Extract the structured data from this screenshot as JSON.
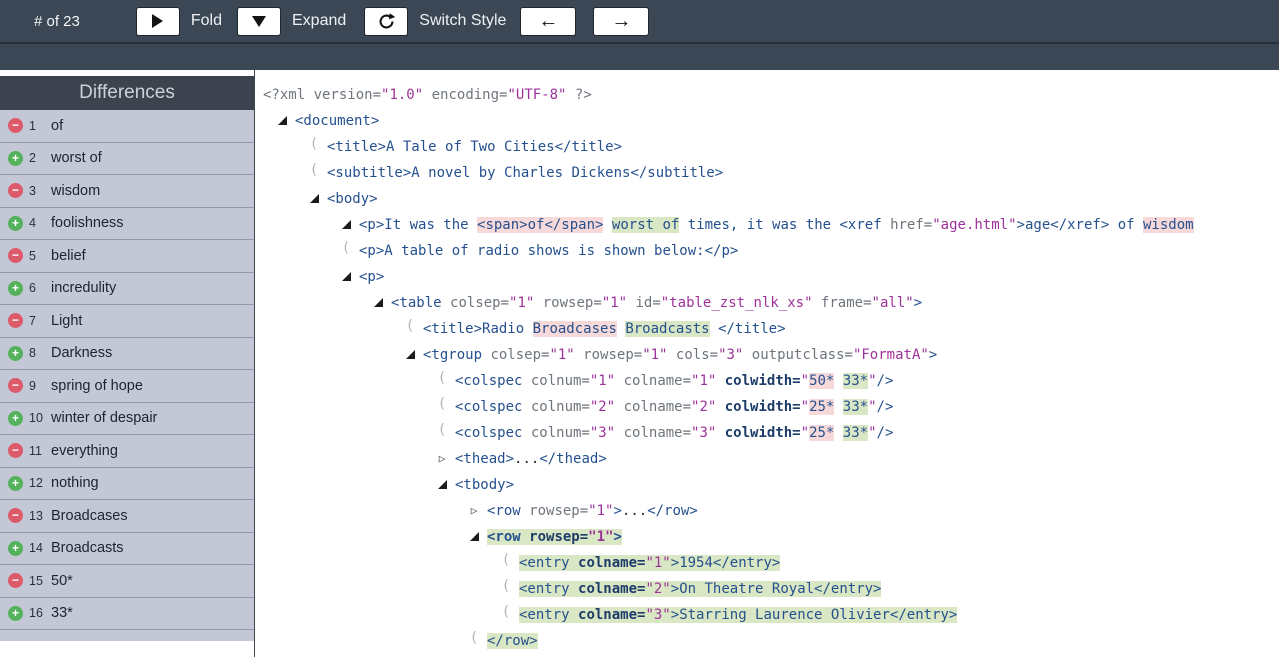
{
  "toolbar": {
    "counter": "# of 23",
    "buttons": [
      {
        "name": "fold",
        "icon": "play-icon",
        "label": "Fold"
      },
      {
        "name": "expand",
        "icon": "triangle-down-icon",
        "label": "Expand"
      },
      {
        "name": "switch-style",
        "icon": "refresh-icon",
        "label": "Switch Style"
      },
      {
        "name": "previous-difference",
        "icon": "arrow-left-icon",
        "label": ""
      },
      {
        "name": "next-difference",
        "icon": "arrow-right-icon",
        "label": ""
      }
    ],
    "arrow_left": "←",
    "arrow_right": "→"
  },
  "sidebar": {
    "title": "Differences",
    "items": [
      {
        "num": 1,
        "kind": "removed",
        "label": "of"
      },
      {
        "num": 2,
        "kind": "added",
        "label": "worst of"
      },
      {
        "num": 3,
        "kind": "removed",
        "label": "wisdom"
      },
      {
        "num": 4,
        "kind": "added",
        "label": "foolishness"
      },
      {
        "num": 5,
        "kind": "removed",
        "label": "belief"
      },
      {
        "num": 6,
        "kind": "added",
        "label": "incredulity"
      },
      {
        "num": 7,
        "kind": "removed",
        "label": "Light"
      },
      {
        "num": 8,
        "kind": "added",
        "label": "Darkness"
      },
      {
        "num": 9,
        "kind": "removed",
        "label": "spring of hope"
      },
      {
        "num": 10,
        "kind": "added",
        "label": "winter of despair"
      },
      {
        "num": 11,
        "kind": "removed",
        "label": "everything"
      },
      {
        "num": 12,
        "kind": "added",
        "label": "nothing"
      },
      {
        "num": 13,
        "kind": "removed",
        "label": "Broadcases"
      },
      {
        "num": 14,
        "kind": "added",
        "label": "Broadcasts"
      },
      {
        "num": 15,
        "kind": "removed",
        "label": "50*"
      },
      {
        "num": 16,
        "kind": "added",
        "label": "33*"
      }
    ]
  },
  "colors": {
    "toolbar_bg": "#3b4754",
    "sidebar_row_bg": "#c4c8d6",
    "removed_badge": "#dd5a6b",
    "added_badge": "#55b25c",
    "removed_hl": "#f8d9da",
    "added_hl": "#d9e7c4",
    "tag_color": "#25508e",
    "attr_color": "#6e757d",
    "value_color": "#9d329a"
  },
  "editor": {
    "lines": [
      {
        "fold": "none",
        "indent": 0,
        "segs": [
          [
            "pi",
            "<?xml version="
          ],
          [
            "val",
            "\"1.0\""
          ],
          [
            "pi",
            " encoding="
          ],
          [
            "val",
            "\"UTF-8\""
          ],
          [
            "pi",
            " ?>"
          ]
        ]
      },
      {
        "fold": "open",
        "indent": 1,
        "segs": [
          [
            "tag",
            "<document>"
          ]
        ]
      },
      {
        "fold": "brace",
        "indent": 2,
        "segs": [
          [
            "tag",
            "<title>"
          ],
          [
            "txt",
            "A Tale of Two Cities"
          ],
          [
            "tag",
            "</title>"
          ]
        ]
      },
      {
        "fold": "brace",
        "indent": 2,
        "segs": [
          [
            "tag",
            "<subtitle>"
          ],
          [
            "txt",
            "A novel by Charles Dickens"
          ],
          [
            "tag",
            "</subtitle>"
          ]
        ]
      },
      {
        "fold": "open",
        "indent": 2,
        "segs": [
          [
            "tag",
            "<body>"
          ]
        ]
      },
      {
        "fold": "open",
        "indent": 3,
        "segs": [
          [
            "tag",
            "<p>"
          ],
          [
            "txt",
            "It was the "
          ],
          [
            "tag hl-del",
            "<span>"
          ],
          [
            "txt hl-del",
            "of"
          ],
          [
            "tag hl-del",
            "</span>"
          ],
          [
            "txt",
            " "
          ],
          [
            "txt hl-add",
            "worst of"
          ],
          [
            "txt",
            " times, it was the "
          ],
          [
            "tag",
            "<xref "
          ],
          [
            "attr",
            "href="
          ],
          [
            "val",
            "\"age.html\""
          ],
          [
            "tag",
            ">"
          ],
          [
            "txt",
            "age"
          ],
          [
            "tag",
            "</xref>"
          ],
          [
            "txt",
            " of "
          ],
          [
            "txt hl-del",
            "wisdom"
          ]
        ]
      },
      {
        "fold": "brace",
        "indent": 3,
        "segs": [
          [
            "tag",
            "<p>"
          ],
          [
            "txt",
            "A table of radio shows is shown below:"
          ],
          [
            "tag",
            "</p>"
          ]
        ]
      },
      {
        "fold": "open",
        "indent": 3,
        "segs": [
          [
            "tag",
            "<p>"
          ]
        ]
      },
      {
        "fold": "open",
        "indent": 4,
        "segs": [
          [
            "tag",
            "<table "
          ],
          [
            "attr",
            "colsep="
          ],
          [
            "val",
            "\"1\""
          ],
          [
            "attr",
            " rowsep="
          ],
          [
            "val",
            "\"1\""
          ],
          [
            "attr",
            " id="
          ],
          [
            "val",
            "\"table_zst_nlk_xs\""
          ],
          [
            "attr",
            " frame="
          ],
          [
            "val",
            "\"all\""
          ],
          [
            "tag",
            ">"
          ]
        ]
      },
      {
        "fold": "brace",
        "indent": 5,
        "segs": [
          [
            "tag",
            "<title>"
          ],
          [
            "txt",
            "Radio "
          ],
          [
            "txt hl-del",
            "Broadcases"
          ],
          [
            "txt",
            " "
          ],
          [
            "txt hl-add",
            "Broadcasts"
          ],
          [
            "txt",
            " "
          ],
          [
            "tag",
            "</title>"
          ]
        ]
      },
      {
        "fold": "open",
        "indent": 5,
        "segs": [
          [
            "tag",
            "<tgroup "
          ],
          [
            "attr",
            "colsep="
          ],
          [
            "val",
            "\"1\""
          ],
          [
            "attr",
            " rowsep="
          ],
          [
            "val",
            "\"1\""
          ],
          [
            "attr",
            " cols="
          ],
          [
            "val",
            "\"3\""
          ],
          [
            "attr",
            " outputclass="
          ],
          [
            "val",
            "\"FormatA\""
          ],
          [
            "tag",
            ">"
          ]
        ]
      },
      {
        "fold": "brace",
        "indent": 6,
        "segs": [
          [
            "tag",
            "<colspec "
          ],
          [
            "attr",
            "colnum="
          ],
          [
            "val",
            "\"1\""
          ],
          [
            "attr",
            " colname="
          ],
          [
            "val",
            "\"1\""
          ],
          [
            "attrb",
            " colwidth="
          ],
          [
            "val",
            "\""
          ],
          [
            "txt hl-del",
            "50*"
          ],
          [
            "txt",
            " "
          ],
          [
            "txt hl-add",
            "33*"
          ],
          [
            "val",
            "\""
          ],
          [
            "tag",
            "/>"
          ]
        ]
      },
      {
        "fold": "brace",
        "indent": 6,
        "segs": [
          [
            "tag",
            "<colspec "
          ],
          [
            "attr",
            "colnum="
          ],
          [
            "val",
            "\"2\""
          ],
          [
            "attr",
            " colname="
          ],
          [
            "val",
            "\"2\""
          ],
          [
            "attrb",
            " colwidth="
          ],
          [
            "val",
            "\""
          ],
          [
            "txt hl-del",
            "25*"
          ],
          [
            "txt",
            " "
          ],
          [
            "txt hl-add",
            "33*"
          ],
          [
            "val",
            "\""
          ],
          [
            "tag",
            "/>"
          ]
        ]
      },
      {
        "fold": "brace",
        "indent": 6,
        "segs": [
          [
            "tag",
            "<colspec "
          ],
          [
            "attr",
            "colnum="
          ],
          [
            "val",
            "\"3\""
          ],
          [
            "attr",
            " colname="
          ],
          [
            "val",
            "\"3\""
          ],
          [
            "attrb",
            " colwidth="
          ],
          [
            "val",
            "\""
          ],
          [
            "txt hl-del",
            "25*"
          ],
          [
            "txt",
            " "
          ],
          [
            "txt hl-add",
            "33*"
          ],
          [
            "val",
            "\""
          ],
          [
            "tag",
            "/>"
          ]
        ]
      },
      {
        "fold": "closed",
        "indent": 6,
        "segs": [
          [
            "tag",
            "<thead>"
          ],
          [
            "dots",
            "..."
          ],
          [
            "tag",
            "</thead>"
          ]
        ]
      },
      {
        "fold": "open",
        "indent": 6,
        "segs": [
          [
            "tag",
            "<tbody>"
          ]
        ]
      },
      {
        "fold": "closed",
        "indent": 7,
        "segs": [
          [
            "tag",
            "<row "
          ],
          [
            "attr",
            "rowsep="
          ],
          [
            "val",
            "\"1\""
          ],
          [
            "tag",
            ">"
          ],
          [
            "dots",
            "..."
          ],
          [
            "tag",
            "</row>"
          ]
        ]
      },
      {
        "fold": "open",
        "indent": 7,
        "segs": [
          [
            "tag hl-add b",
            "<row "
          ],
          [
            "attrb hl-add",
            "rowsep="
          ],
          [
            "val hl-add b",
            "\"1\""
          ],
          [
            "tag hl-add b",
            ">"
          ]
        ]
      },
      {
        "fold": "brace",
        "indent": 8,
        "segs": [
          [
            "tag hl-add",
            "<entry "
          ],
          [
            "attrb hl-add",
            "colname="
          ],
          [
            "val hl-add",
            "\"1\""
          ],
          [
            "tag hl-add",
            ">"
          ],
          [
            "txt hl-add",
            "1954"
          ],
          [
            "tag hl-add",
            "</entry>"
          ]
        ]
      },
      {
        "fold": "brace",
        "indent": 8,
        "segs": [
          [
            "tag hl-add",
            "<entry "
          ],
          [
            "attrb hl-add",
            "colname="
          ],
          [
            "val hl-add",
            "\"2\""
          ],
          [
            "tag hl-add",
            ">"
          ],
          [
            "txt hl-add",
            "On Theatre Royal"
          ],
          [
            "tag hl-add",
            "</entry>"
          ]
        ]
      },
      {
        "fold": "brace",
        "indent": 8,
        "segs": [
          [
            "tag hl-add",
            "<entry "
          ],
          [
            "attrb hl-add",
            "colname="
          ],
          [
            "val hl-add",
            "\"3\""
          ],
          [
            "tag hl-add",
            ">"
          ],
          [
            "txt hl-add",
            "Starring Laurence Olivier"
          ],
          [
            "tag hl-add",
            "</entry>"
          ]
        ]
      },
      {
        "fold": "brace",
        "indent": 7,
        "segs": [
          [
            "tag hl-add",
            "</row>"
          ]
        ]
      }
    ]
  }
}
